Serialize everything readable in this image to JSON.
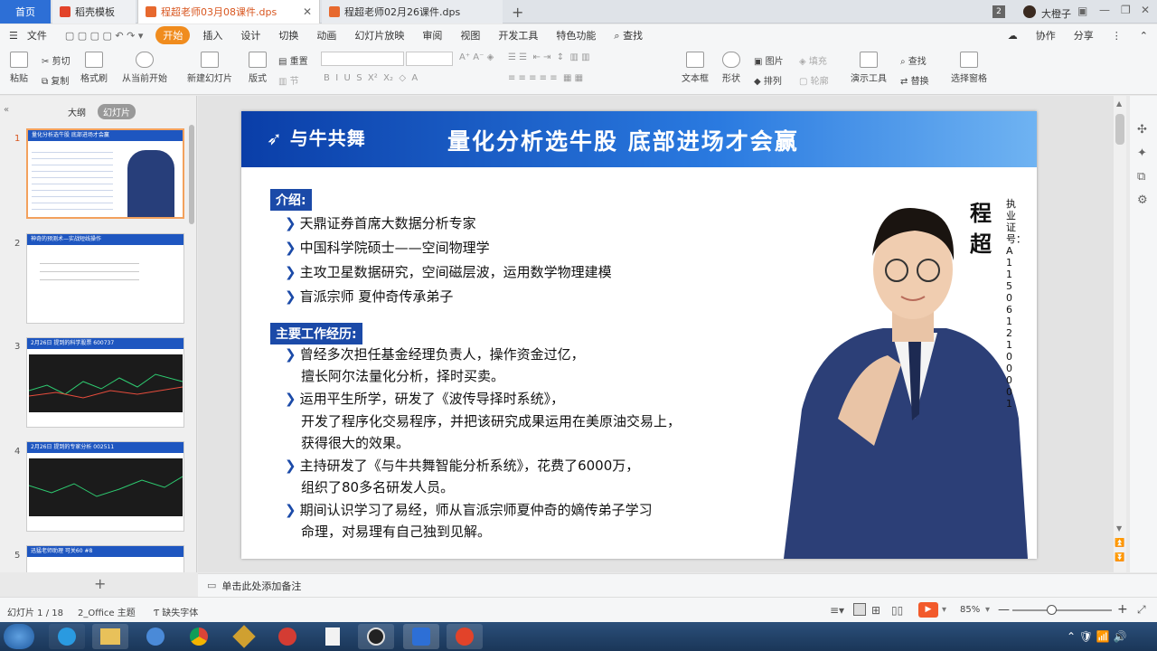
{
  "tabs": {
    "home": "首页",
    "template": "稻壳模板",
    "active_file": "程超老师03月08课件.dps",
    "other_file": "程超老师02月26课件.dps",
    "badge": "2",
    "user": "大橙子"
  },
  "menu": {
    "file": "文件",
    "items": [
      "开始",
      "插入",
      "设计",
      "切换",
      "动画",
      "幻灯片放映",
      "审阅",
      "视图",
      "开发工具",
      "特色功能"
    ],
    "search": "查找",
    "collab": "协作",
    "share": "分享"
  },
  "ribbon": {
    "paste": "粘贴",
    "cut": "剪切",
    "copy": "复制",
    "format_painter": "格式刷",
    "from_current": "从当前开始",
    "new_slide": "新建幻灯片",
    "layout": "版式",
    "section": "节",
    "reset": "重置",
    "textbox": "文本框",
    "shape": "形状",
    "picture": "图片",
    "fill": "填充",
    "arrange": "排列",
    "outline": "轮廓",
    "present_tool": "演示工具",
    "find": "查找",
    "replace": "替换",
    "select_pane": "选择窗格"
  },
  "panel": {
    "outline_tab": "大纲",
    "slides_tab": "幻灯片",
    "thumbs": [
      {
        "num": "1",
        "title": "量化分析选牛股 底部进场才会赢"
      },
      {
        "num": "2",
        "title": "神奇的预测术—实战短线操作"
      },
      {
        "num": "3",
        "title": "2月26日 提到的科学股票 600737"
      },
      {
        "num": "4",
        "title": "2月26日 提到的专家分析 002511"
      },
      {
        "num": "5",
        "title": "迅猛老师助理 可关60 #8"
      }
    ]
  },
  "slide": {
    "brand": "与牛共舞",
    "title": "量化分析选牛股  底部进场才会赢",
    "intro_label": "介绍:",
    "intro": [
      "天鼎证券首席大数据分析专家",
      "中国科学院硕士——空间物理学",
      "主攻卫星数据研究，空间磁层波，运用数学物理建模",
      "盲派宗师  夏仲奇传承弟子"
    ],
    "work_label": "主要工作经历:",
    "work": [
      [
        "曾经多次担任基金经理负责人，操作资金过亿，",
        "擅长阿尔法量化分析，择时买卖。"
      ],
      [
        "运用平生所学，研发了《波传导择时系统》，",
        "开发了程序化交易程序，并把该研究成果运用在美原油交易上，",
        "获得很大的效果。"
      ],
      [
        "主持研发了《与牛共舞智能分析系统》，花费了6000万，",
        "组织了80多名研发人员。"
      ],
      [
        "期间认识学习了易经，师从盲派宗师夏仲奇的嫡传弟子学习",
        "命理，对易理有自己独到见解。"
      ]
    ],
    "name_chars": "程超",
    "license": "执业证号：A1150612100001"
  },
  "notes": {
    "placeholder": "单击此处添加备注"
  },
  "status": {
    "slide_info": "幻灯片 1 / 18",
    "theme": "2_Office 主题",
    "missing_font": "缺失字体",
    "zoom": "85%"
  }
}
